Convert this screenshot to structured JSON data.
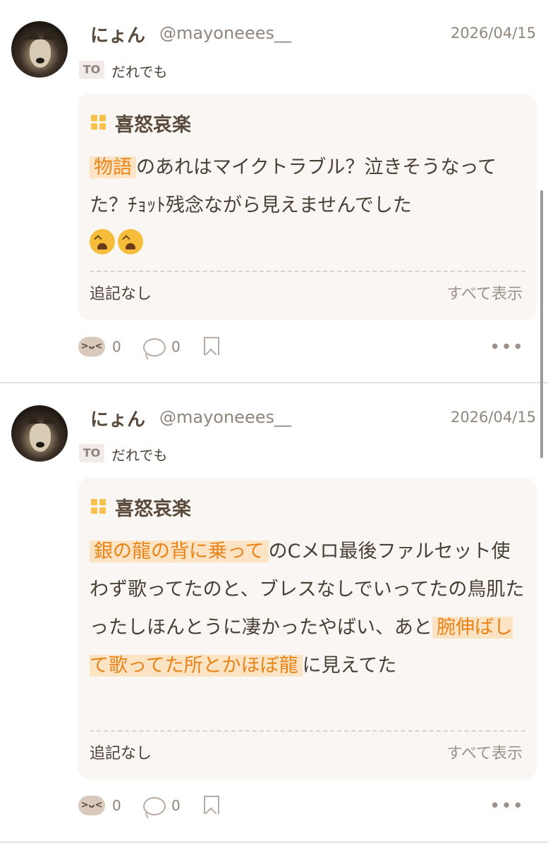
{
  "posts": [
    {
      "name": "にょん",
      "handle": "@mayoneees__",
      "date": "2026/04/15",
      "to_label": "TO",
      "to_text": "だれでも",
      "category": "喜怒哀楽",
      "body_hl1": "物語",
      "body_rest1": "のあれはマイクトラブル？泣きそうなってた？ﾁｮｯﾄ残念ながら見えませんでした",
      "tsuiki": "追記なし",
      "showall": "すべて表示",
      "reactions": "0",
      "comments": "0"
    },
    {
      "name": "にょん",
      "handle": "@mayoneees__",
      "date": "2026/04/15",
      "to_label": "TO",
      "to_text": "だれでも",
      "category": "喜怒哀楽",
      "body_hl1": "銀の龍の背に乗って",
      "body_rest1": "のCメロ最後ファルセット使わず歌ってたのと、ブレスなしでいってたの鳥肌たったしほんとうに凄かったやばい、あと",
      "body_hl2": "腕伸ばして歌ってた所とかほぼ龍",
      "body_rest2": "に見えてた",
      "tsuiki": "追記なし",
      "showall": "すべて表示",
      "reactions": "0",
      "comments": "0"
    }
  ],
  "icons": {
    "reaction": "laughing-face-icon",
    "comment": "speech-bubble-icon",
    "bookmark": "bookmark-icon",
    "more": "more-dots-icon",
    "category": "grid-icon"
  },
  "colors": {
    "highlight_text": "#e8841a",
    "highlight_bg": "#fbe3c4",
    "card_bg": "#f9f6f3",
    "category_icon": "#f7c14c"
  }
}
